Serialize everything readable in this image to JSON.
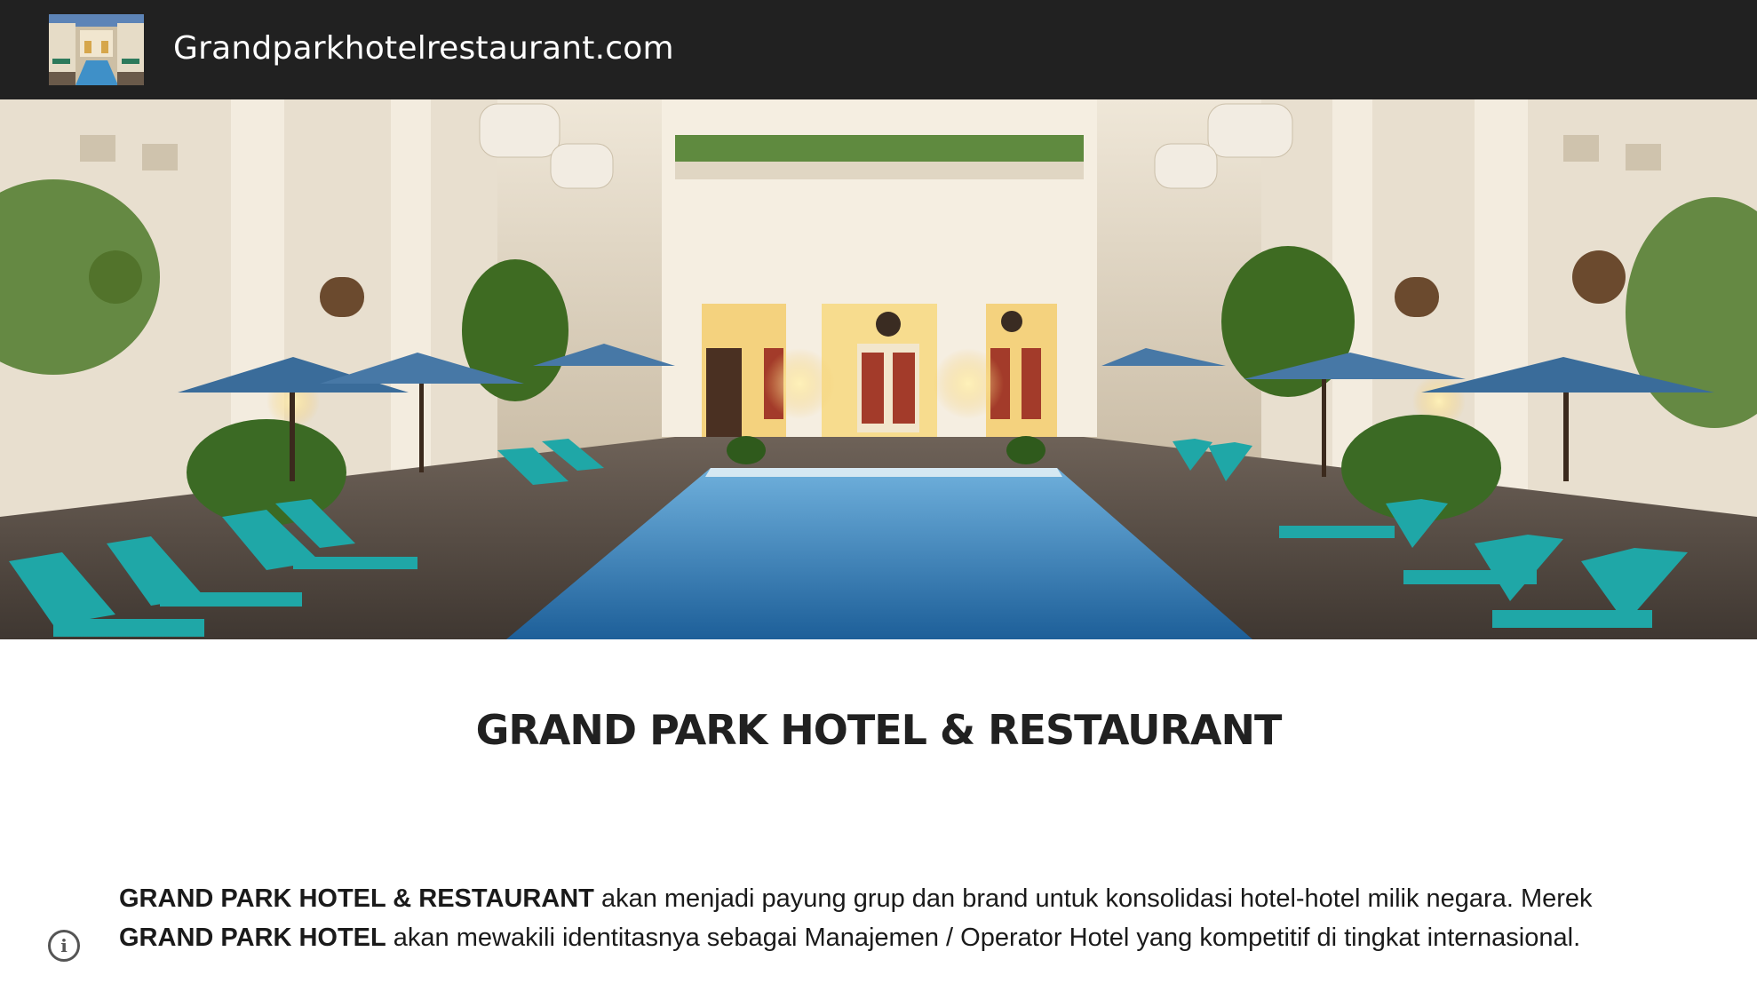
{
  "header": {
    "site_title": "Grandparkhotelrestaurant.com",
    "logo_alt": "hotel-courtyard-thumbnail"
  },
  "hero": {
    "description_icon": "hotel-courtyard-pool-photo"
  },
  "main": {
    "title": "GRAND PARK HOTEL & RESTAURANT",
    "paragraph": {
      "brand_1": "GRAND PARK HOTEL  & RESTAURANT",
      "text_1": "  akan menjadi payung grup dan brand untuk konsolidasi hotel-hotel milik negara. Merek ",
      "brand_2": "GRAND PARK HOTEL",
      "text_2": " akan mewakili identitasnya sebagai Manajemen / Operator Hotel yang kompetitif di tingkat internasional."
    }
  },
  "icons": {
    "info": "info-icon"
  },
  "colors": {
    "header_bg": "#212121",
    "header_text": "#ffffff",
    "title_text": "#212121",
    "pool": "#3f8fc6",
    "lounger": "#1fa7a7",
    "umbrella": "#3a6c9a"
  }
}
